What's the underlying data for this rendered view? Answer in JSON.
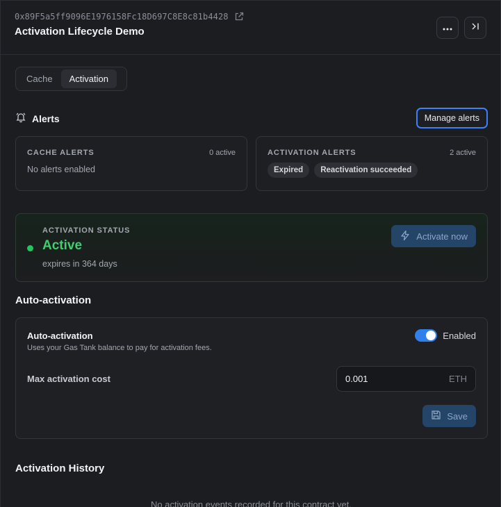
{
  "header": {
    "address": "0x89F5a5ff9096E1976158Fc18D697C8E8c81b4428",
    "title": "Activation Lifecycle Demo"
  },
  "tabs": [
    {
      "label": "Cache",
      "active": false
    },
    {
      "label": "Activation",
      "active": true
    }
  ],
  "alerts": {
    "title": "Alerts",
    "manage_label": "Manage alerts",
    "cache": {
      "label": "CACHE ALERTS",
      "count": "0 active",
      "empty": "No alerts enabled"
    },
    "activation": {
      "label": "ACTIVATION ALERTS",
      "count": "2 active",
      "chips": [
        "Expired",
        "Reactivation succeeded"
      ]
    }
  },
  "status": {
    "label": "ACTIVATION STATUS",
    "value": "Active",
    "expiry": "expires in 364 days",
    "activate_label": "Activate now"
  },
  "auto_activation": {
    "section_title": "Auto-activation",
    "title": "Auto-activation",
    "description": "Uses your Gas Tank balance to pay for activation fees.",
    "toggle_label": "Enabled",
    "enabled": true,
    "max_cost_label": "Max activation cost",
    "max_cost_value": "0.001",
    "max_cost_unit": "ETH",
    "save_label": "Save"
  },
  "history": {
    "title": "Activation History",
    "empty": "No activation events recorded for this contract yet."
  },
  "colors": {
    "background": "#1c1d21",
    "accent": "#3b82f6",
    "success": "#22c55e",
    "button_muted": "#244468"
  },
  "icons": {
    "external_link": "external-link-icon",
    "more": "more-icon",
    "collapse": "collapse-panel-icon",
    "bell": "bell-icon",
    "lightning": "lightning-icon",
    "save": "save-icon"
  }
}
